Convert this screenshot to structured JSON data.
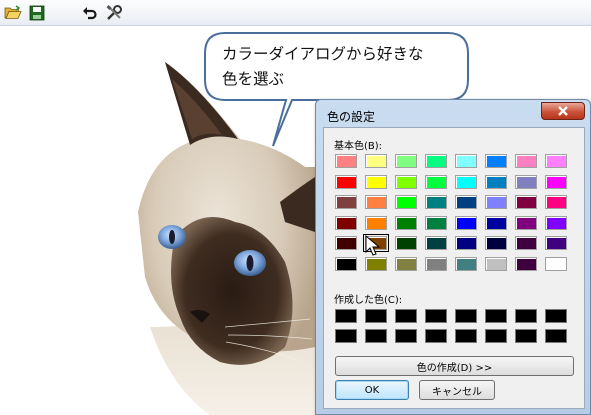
{
  "toolbar": {
    "icons": [
      "open-folder-icon",
      "save-icon",
      "undo-icon",
      "tools-icon"
    ]
  },
  "bubble": {
    "line1": "カラーダイアログから好きな",
    "line2": "色を選ぶ"
  },
  "dialog": {
    "title": "色の設定",
    "basic_label": "基本色(B):",
    "custom_label": "作成した色(C):",
    "define_custom_label": "色の作成(D) >>",
    "ok_label": "OK",
    "cancel_label": "キャンセル",
    "basic_colors": [
      "#ff8080",
      "#ffff80",
      "#80ff80",
      "#00ff80",
      "#80ffff",
      "#0080ff",
      "#ff80c0",
      "#ff80ff",
      "#ff0000",
      "#ffff00",
      "#80ff00",
      "#00ff40",
      "#00ffff",
      "#0080c0",
      "#8080c0",
      "#ff00ff",
      "#804040",
      "#ff8040",
      "#00ff00",
      "#008080",
      "#004080",
      "#8080ff",
      "#800040",
      "#ff0080",
      "#800000",
      "#ff8000",
      "#008000",
      "#008040",
      "#0000ff",
      "#0000a0",
      "#800080",
      "#8000ff",
      "#400000",
      "#804000",
      "#004000",
      "#004040",
      "#000080",
      "#000040",
      "#400040",
      "#400080",
      "#000000",
      "#808000",
      "#808040",
      "#808080",
      "#408080",
      "#c0c0c0",
      "#400040",
      "#ffffff"
    ],
    "selected_color": "#804000",
    "custom_colors": [
      "#000000",
      "#000000",
      "#000000",
      "#000000",
      "#000000",
      "#000000",
      "#000000",
      "#000000",
      "#000000",
      "#000000",
      "#000000",
      "#000000",
      "#000000",
      "#000000",
      "#000000",
      "#000000"
    ]
  }
}
